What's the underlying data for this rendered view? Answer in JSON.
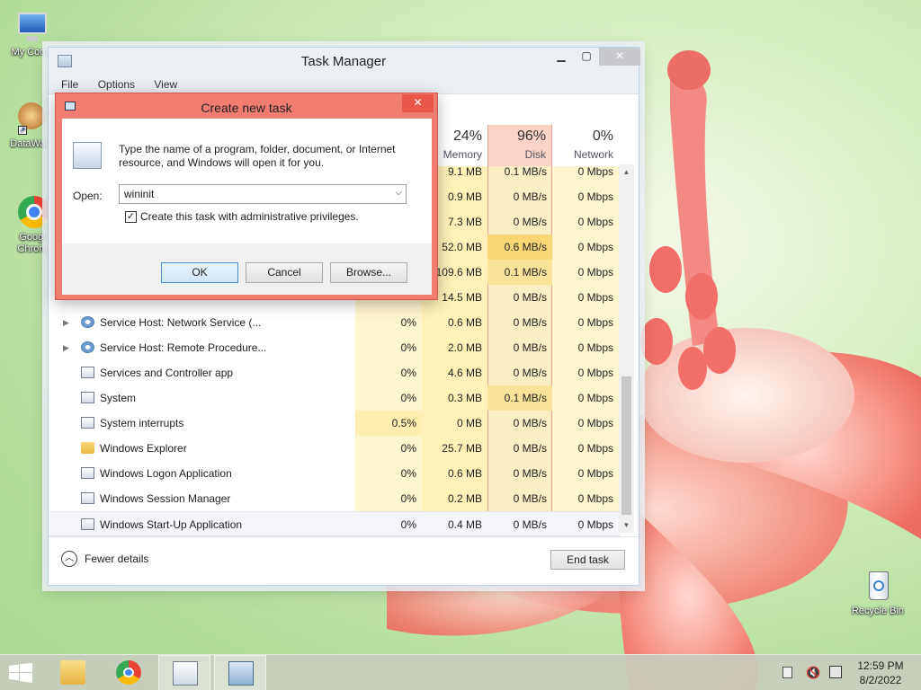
{
  "desktop": {
    "icons": [
      {
        "label": "My Comp"
      },
      {
        "label": "DataWag"
      },
      {
        "label": "Googl Chrom"
      },
      {
        "label": "Recycle Bin"
      }
    ]
  },
  "task_manager": {
    "title": "Task Manager",
    "menu": [
      "File",
      "Options",
      "View"
    ],
    "columns": [
      {
        "pct": "24%",
        "name": "Memory"
      },
      {
        "pct": "96%",
        "name": "Disk"
      },
      {
        "pct": "0%",
        "name": "Network"
      }
    ],
    "rows": [
      {
        "name": "",
        "cpu": "",
        "mem": "9.1 MB",
        "disk": "0.1 MB/s",
        "net": "0 Mbps"
      },
      {
        "name": "",
        "cpu": "",
        "mem": "0.9 MB",
        "disk": "0 MB/s",
        "net": "0 Mbps"
      },
      {
        "name": "",
        "cpu": "",
        "mem": "7.3 MB",
        "disk": "0 MB/s",
        "net": "0 Mbps"
      },
      {
        "name": "",
        "cpu": "",
        "mem": "52.0 MB",
        "disk": "0.6 MB/s",
        "net": "0 Mbps"
      },
      {
        "name": "",
        "cpu": "",
        "mem": "109.6 MB",
        "disk": "0.1 MB/s",
        "net": "0 Mbps"
      },
      {
        "name": "",
        "cpu": "",
        "mem": "14.5 MB",
        "disk": "0 MB/s",
        "net": "0 Mbps"
      },
      {
        "name": "Service Host: Network Service (...",
        "cpu": "0%",
        "mem": "0.6 MB",
        "disk": "0 MB/s",
        "net": "0 Mbps"
      },
      {
        "name": "Service Host: Remote Procedure...",
        "cpu": "0%",
        "mem": "2.0 MB",
        "disk": "0 MB/s",
        "net": "0 Mbps"
      },
      {
        "name": "Services and Controller app",
        "cpu": "0%",
        "mem": "4.6 MB",
        "disk": "0 MB/s",
        "net": "0 Mbps"
      },
      {
        "name": "System",
        "cpu": "0%",
        "mem": "0.3 MB",
        "disk": "0.1 MB/s",
        "net": "0 Mbps"
      },
      {
        "name": "System interrupts",
        "cpu": "0.5%",
        "mem": "0 MB",
        "disk": "0 MB/s",
        "net": "0 Mbps"
      },
      {
        "name": "Windows Explorer",
        "cpu": "0%",
        "mem": "25.7 MB",
        "disk": "0 MB/s",
        "net": "0 Mbps"
      },
      {
        "name": "Windows Logon Application",
        "cpu": "0%",
        "mem": "0.6 MB",
        "disk": "0 MB/s",
        "net": "0 Mbps"
      },
      {
        "name": "Windows Session Manager",
        "cpu": "0%",
        "mem": "0.2 MB",
        "disk": "0 MB/s",
        "net": "0 Mbps"
      },
      {
        "name": "Windows Start-Up Application",
        "cpu": "0%",
        "mem": "0.4 MB",
        "disk": "0 MB/s",
        "net": "0 Mbps"
      }
    ],
    "fewer_details": "Fewer details",
    "end_task": "End task",
    "colors": {
      "cpu_bg": "#fff4c4",
      "mem_bg": "#fff0b3",
      "disk_bg": "#fbeec1",
      "disk_hi": "#f9d777",
      "net_bg": "#fff4c4",
      "disk_hdr": "#fbd3c7",
      "disk_border": "#e7a393"
    }
  },
  "dialog": {
    "title": "Create new task",
    "description": "Type the name of a program, folder, document, or Internet resource, and Windows will open it for you.",
    "open_label": "Open:",
    "open_value": "wininit",
    "admin_label": "Create this task with administrative privileges.",
    "admin_checked": true,
    "ok": "OK",
    "cancel": "Cancel",
    "browse": "Browse...",
    "close_glyph": "✕"
  },
  "taskbar": {
    "time": "12:59 PM",
    "date": "8/2/2022"
  }
}
